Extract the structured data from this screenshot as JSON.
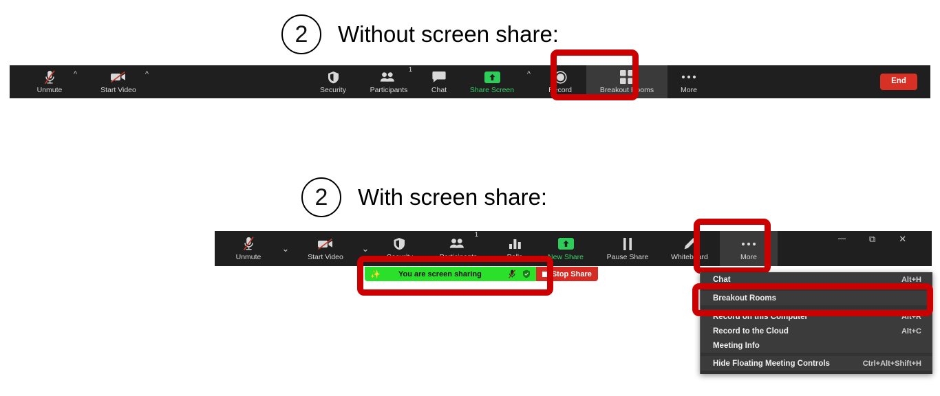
{
  "steps": [
    {
      "number": "2",
      "text": "Without screen share:"
    },
    {
      "number": "2",
      "text": "With screen share:"
    }
  ],
  "colors": {
    "annotation_red": "#cc0000",
    "toolbar_bg": "#1f1f1f",
    "share_green": "#2ae02a",
    "accent_green": "#3ad16a",
    "end_red": "#d93025",
    "menu_bg": "#3b3b3b"
  },
  "toolbar_without_share": {
    "items": [
      {
        "label": "Unmute",
        "icon": "mic-muted-icon",
        "caret": "^"
      },
      {
        "label": "Start Video",
        "icon": "video-muted-icon",
        "caret": "^"
      },
      {
        "label": "Security",
        "icon": "shield-icon"
      },
      {
        "label": "Participants",
        "icon": "participants-icon",
        "badge": "1"
      },
      {
        "label": "Chat",
        "icon": "chat-bubble-icon"
      },
      {
        "label": "Share Screen",
        "icon": "share-screen-icon",
        "caret": "^"
      },
      {
        "label": "Record",
        "icon": "record-circle-icon"
      },
      {
        "label": "Breakout Rooms",
        "icon": "breakout-rooms-icon"
      },
      {
        "label": "More",
        "icon": "more-dots-icon"
      }
    ],
    "end_button": "End"
  },
  "toolbar_with_share": {
    "items": [
      {
        "label": "Unmute",
        "icon": "mic-muted-icon",
        "chevron": "⌄"
      },
      {
        "label": "Start Video",
        "icon": "video-muted-icon",
        "chevron": "⌄"
      },
      {
        "label": "Security",
        "icon": "shield-icon"
      },
      {
        "label": "Participants",
        "icon": "participants-icon",
        "badge": "1"
      },
      {
        "label": "Polls",
        "icon": "polls-bars-icon"
      },
      {
        "label": "New Share",
        "icon": "share-screen-icon"
      },
      {
        "label": "Pause Share",
        "icon": "pause-icon"
      },
      {
        "label": "Whiteboard",
        "icon": "pencil-icon"
      },
      {
        "label": "More",
        "icon": "more-dots-icon"
      }
    ],
    "window_controls": [
      "minimize-icon",
      "restore-icon",
      "close-icon"
    ]
  },
  "share_status_bar": {
    "lock_icon": "screen-share-lock-icon",
    "text": "You are screen sharing",
    "mic_icon": "mic-muted-small-icon",
    "shield_icon": "shield-small-icon",
    "stop_button": "Stop Share"
  },
  "more_menu": {
    "rows": [
      {
        "label": "Chat",
        "accel": "Alt+H"
      },
      {
        "label": "Breakout Rooms",
        "accel": ""
      },
      {
        "label": "Record on this Computer",
        "accel": "Alt+R"
      },
      {
        "label": "Record to the Cloud",
        "accel": "Alt+C"
      },
      {
        "label": "Meeting Info",
        "accel": ""
      },
      {
        "label": "Hide Floating Meeting Controls",
        "accel": "Ctrl+Alt+Shift+H"
      }
    ]
  }
}
